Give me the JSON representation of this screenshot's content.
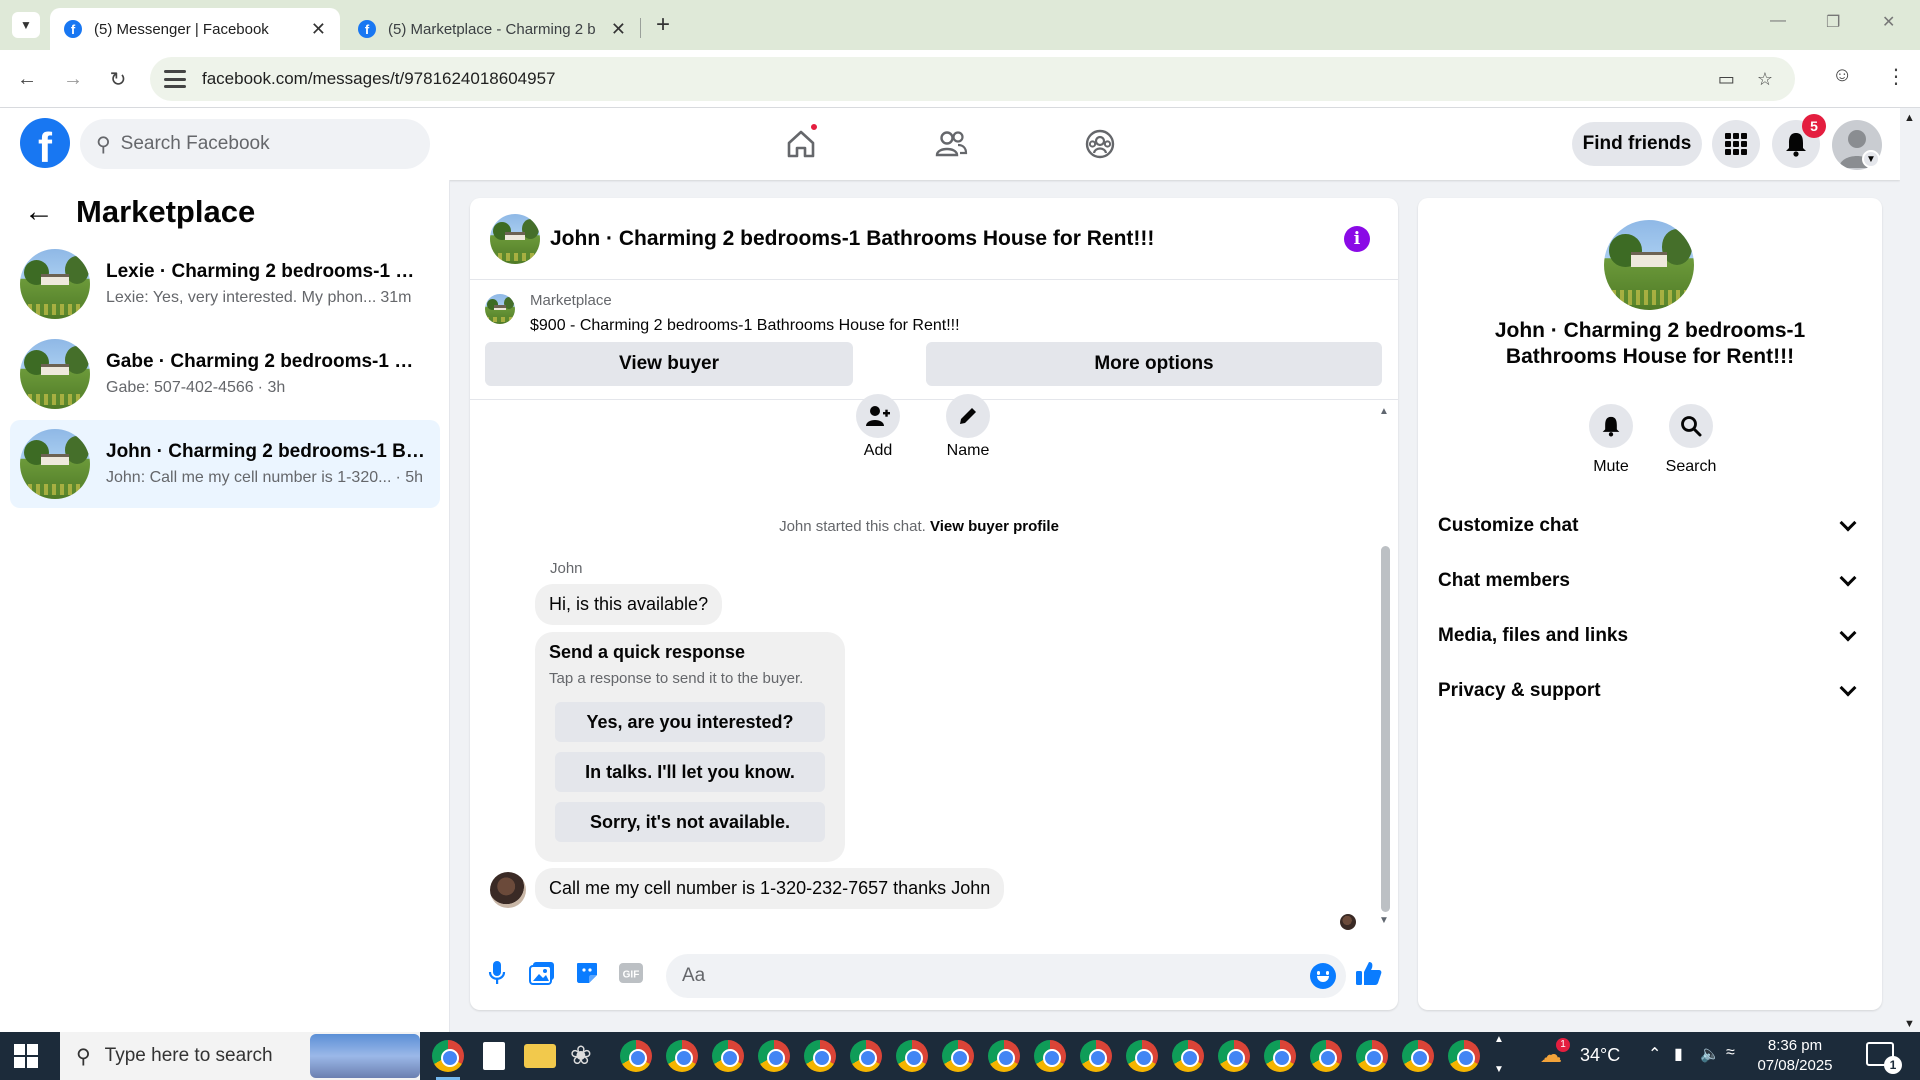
{
  "browser": {
    "tabs": [
      {
        "title": "(5) Messenger | Facebook",
        "active": true
      },
      {
        "title": "(5) Marketplace - Charming 2 b",
        "active": false
      }
    ],
    "url": "facebook.com/messages/t/9781624018604957"
  },
  "fb_header": {
    "search_placeholder": "Search Facebook",
    "find_friends_label": "Find friends",
    "notification_count": "5"
  },
  "sidebar": {
    "title": "Marketplace",
    "conversations": [
      {
        "name": "Lexie · Charming 2 bedrooms-1 Ba...",
        "preview": "Lexie: Yes, very interested. My phon...",
        "time": "31m",
        "selected": false
      },
      {
        "name": "Gabe · Charming 2 bedrooms-1 Ba...",
        "preview": "Gabe: 507-402-4566",
        "time": "· 3h",
        "selected": false
      },
      {
        "name": "John · Charming 2 bedrooms-1 Bat...",
        "preview": "John: Call me my cell number is 1-320...",
        "time": "· 5h",
        "selected": true
      }
    ]
  },
  "chat": {
    "title": "John · Charming 2 bedrooms-1 Bathrooms House for Rent!!!",
    "marketplace_label": "Marketplace",
    "listing": "$900 - Charming 2 bedrooms-1 Bathrooms House for Rent!!!",
    "view_buyer_label": "View buyer",
    "more_options_label": "More options",
    "actions": {
      "add_label": "Add",
      "name_label": "Name"
    },
    "started_text": "John started this chat.",
    "view_buyer_profile_label": "View buyer profile",
    "sender_name": "John",
    "first_message": "Hi, is this available?",
    "quick_response": {
      "title": "Send a quick response",
      "subtitle": "Tap a response to send it to the buyer.",
      "options": [
        "Yes, are you interested?",
        "In talks. I'll let you know.",
        "Sorry, it's not available."
      ]
    },
    "last_message": "Call me my cell number is 1-320-232-7657 thanks John",
    "composer_placeholder": "Aa"
  },
  "info_panel": {
    "title": "John · Charming 2 bedrooms-1 Bathrooms House for Rent!!!",
    "mute_label": "Mute",
    "search_label": "Search",
    "sections": [
      "Customize chat",
      "Chat members",
      "Media, files and links",
      "Privacy & support"
    ]
  },
  "taskbar": {
    "search_placeholder": "Type here to search",
    "weather": "34°C",
    "weather_alert": "1",
    "time": "8:36 pm",
    "date": "07/08/2025",
    "notification_count": "1"
  },
  "colors": {
    "facebook_blue": "#1877f2",
    "messenger_purple": "#8a0ae6",
    "notification_red": "#e41e3f",
    "selected_conversation": "#ebf5ff"
  }
}
